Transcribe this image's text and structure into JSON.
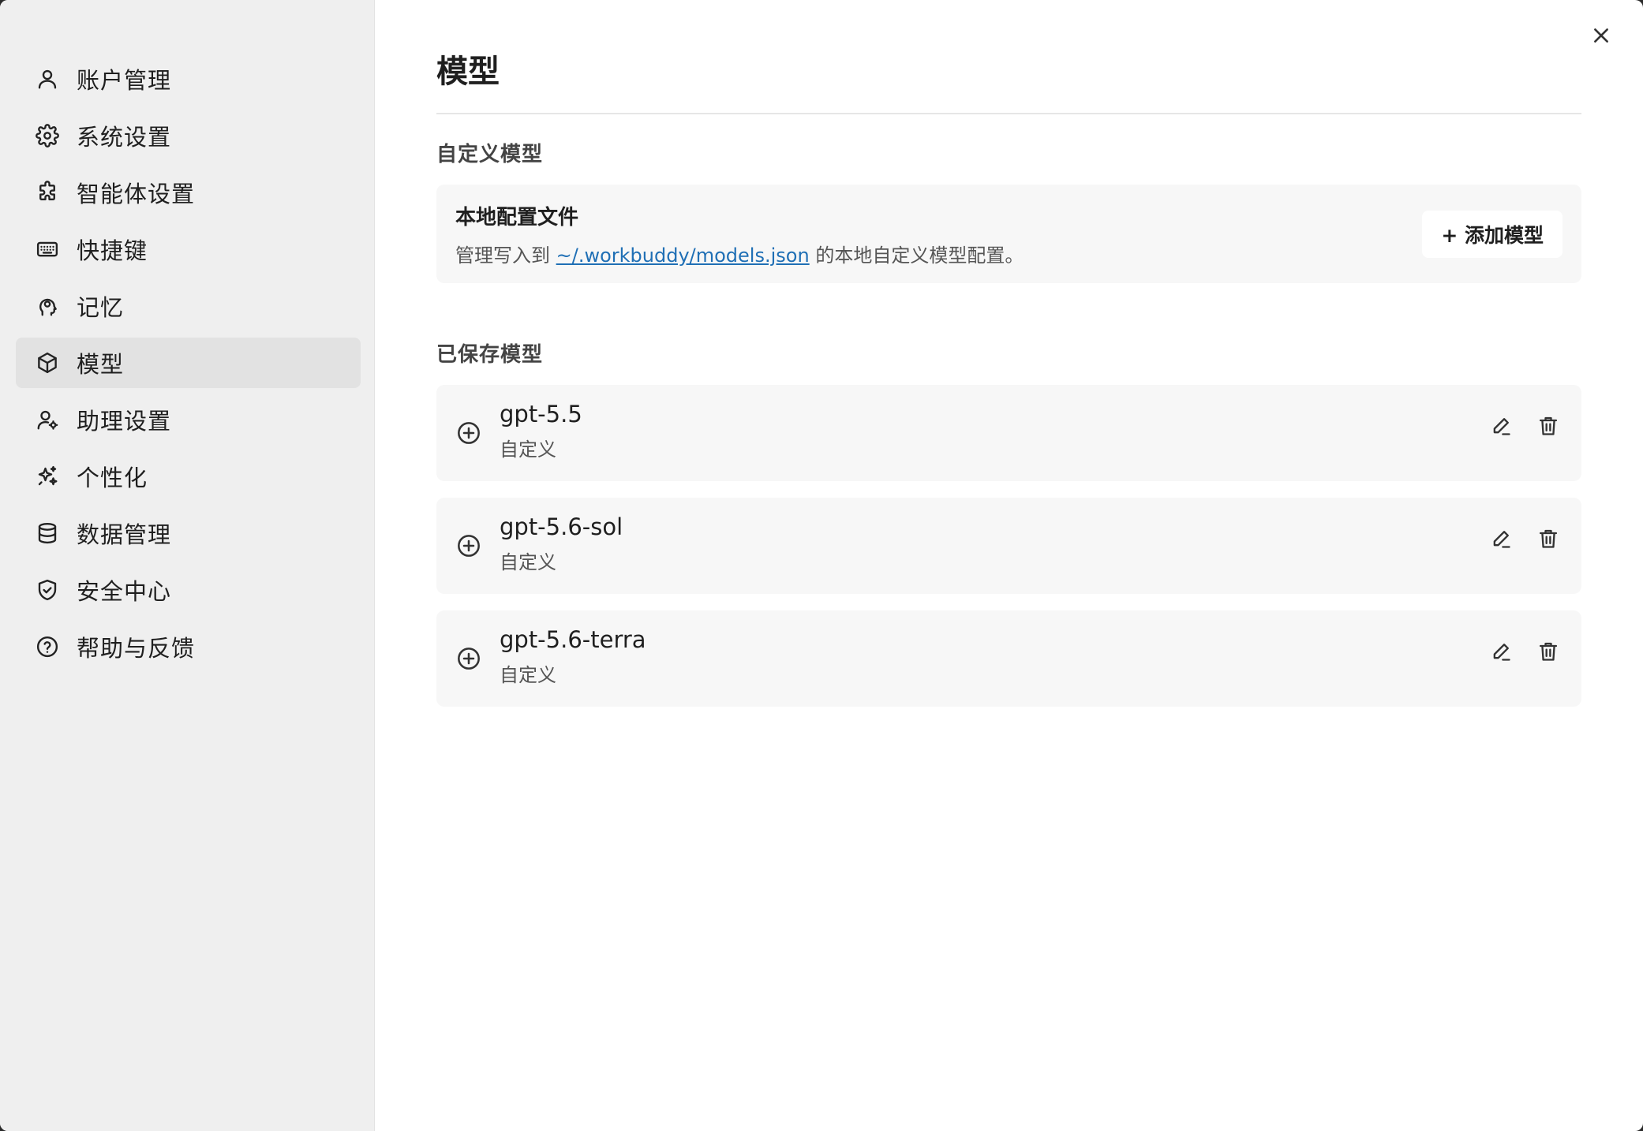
{
  "sidebar": {
    "items": [
      {
        "label": "账户管理",
        "icon": "user-icon"
      },
      {
        "label": "系统设置",
        "icon": "gear-icon"
      },
      {
        "label": "智能体设置",
        "icon": "puzzle-icon"
      },
      {
        "label": "快捷键",
        "icon": "keyboard-icon"
      },
      {
        "label": "记忆",
        "icon": "brain-icon"
      },
      {
        "label": "模型",
        "icon": "cube-icon",
        "active": true
      },
      {
        "label": "助理设置",
        "icon": "user-gear-icon"
      },
      {
        "label": "个性化",
        "icon": "sparkles-icon"
      },
      {
        "label": "数据管理",
        "icon": "database-icon"
      },
      {
        "label": "安全中心",
        "icon": "shield-check-icon"
      },
      {
        "label": "帮助与反馈",
        "icon": "help-circle-icon"
      }
    ]
  },
  "main": {
    "title": "模型",
    "custom_section": {
      "title": "自定义模型",
      "config": {
        "title": "本地配置文件",
        "desc_prefix": "管理写入到 ",
        "link": "~/.workbuddy/models.json",
        "desc_suffix": " 的本地自定义模型配置。"
      },
      "add_button": "+ 添加模型"
    },
    "saved_section": {
      "title": "已保存模型",
      "models": [
        {
          "name": "gpt-5.5",
          "type": "自定义"
        },
        {
          "name": "gpt-5.6-sol",
          "type": "自定义"
        },
        {
          "name": "gpt-5.6-terra",
          "type": "自定义"
        }
      ]
    }
  },
  "colors": {
    "sidebar_bg": "#efefef",
    "active_bg": "#e2e2e2",
    "card_bg": "#f7f7f7",
    "link": "#1f6fb5"
  }
}
